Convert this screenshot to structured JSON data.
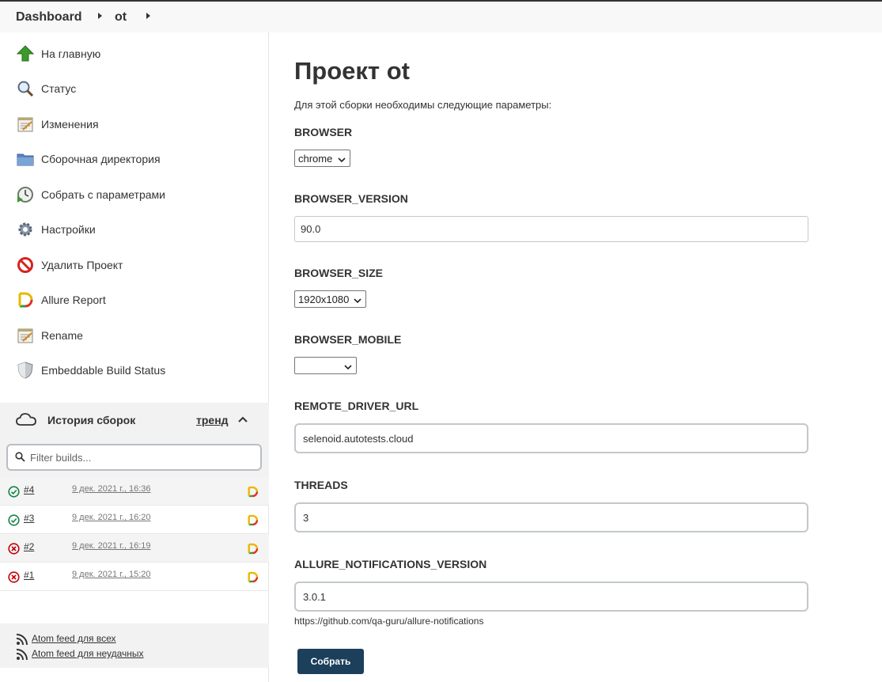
{
  "breadcrumb": {
    "dashboard": "Dashboard",
    "project": "ot"
  },
  "sidebar": {
    "items": [
      {
        "label": "На главную",
        "icon": "up-arrow-icon"
      },
      {
        "label": "Статус",
        "icon": "magnifier-icon"
      },
      {
        "label": "Изменения",
        "icon": "notepad-icon"
      },
      {
        "label": "Сборочная директория",
        "icon": "folder-icon"
      },
      {
        "label": "Собрать с параметрами",
        "icon": "clock-play-icon"
      },
      {
        "label": "Настройки",
        "icon": "gear-icon"
      },
      {
        "label": "Удалить Проект",
        "icon": "no-entry-icon"
      },
      {
        "label": "Allure Report",
        "icon": "allure-icon"
      },
      {
        "label": "Rename",
        "icon": "notepad-icon"
      },
      {
        "label": "Embeddable Build Status",
        "icon": "shield-icon"
      }
    ],
    "history": {
      "title": "История сборок",
      "trend": "тренд",
      "filter_placeholder": "Filter builds...",
      "builds": [
        {
          "number": "#4",
          "date": "9 дек. 2021 г., 16:36",
          "status": "success"
        },
        {
          "number": "#3",
          "date": "9 дек. 2021 г., 16:20",
          "status": "success"
        },
        {
          "number": "#2",
          "date": "9 дек. 2021 г., 16:19",
          "status": "failed"
        },
        {
          "number": "#1",
          "date": "9 дек. 2021 г., 15:20",
          "status": "failed"
        }
      ],
      "feeds": {
        "all": "Atom feed для всех",
        "failed": "Atom feed для неудачных"
      }
    }
  },
  "main": {
    "title": "Проект ot",
    "description": "Для этой сборки необходимы следующие параметры:",
    "params": {
      "browser": {
        "label": "BROWSER",
        "value": "chrome"
      },
      "browser_version": {
        "label": "BROWSER_VERSION",
        "value": "90.0"
      },
      "browser_size": {
        "label": "BROWSER_SIZE",
        "value": "1920x1080"
      },
      "browser_mobile": {
        "label": "BROWSER_MOBILE",
        "value": ""
      },
      "remote_driver_url": {
        "label": "REMOTE_DRIVER_URL",
        "value": "selenoid.autotests.cloud"
      },
      "threads": {
        "label": "THREADS",
        "value": "3"
      },
      "allure_notifications_version": {
        "label": "ALLURE_NOTIFICATIONS_VERSION",
        "value": "3.0.1",
        "help": "https://github.com/qa-guru/allure-notifications"
      }
    },
    "submit_label": "Собрать"
  },
  "colors": {
    "submit_bg": "#1c3f5c",
    "success": "#138347",
    "failed": "#c4000a"
  }
}
